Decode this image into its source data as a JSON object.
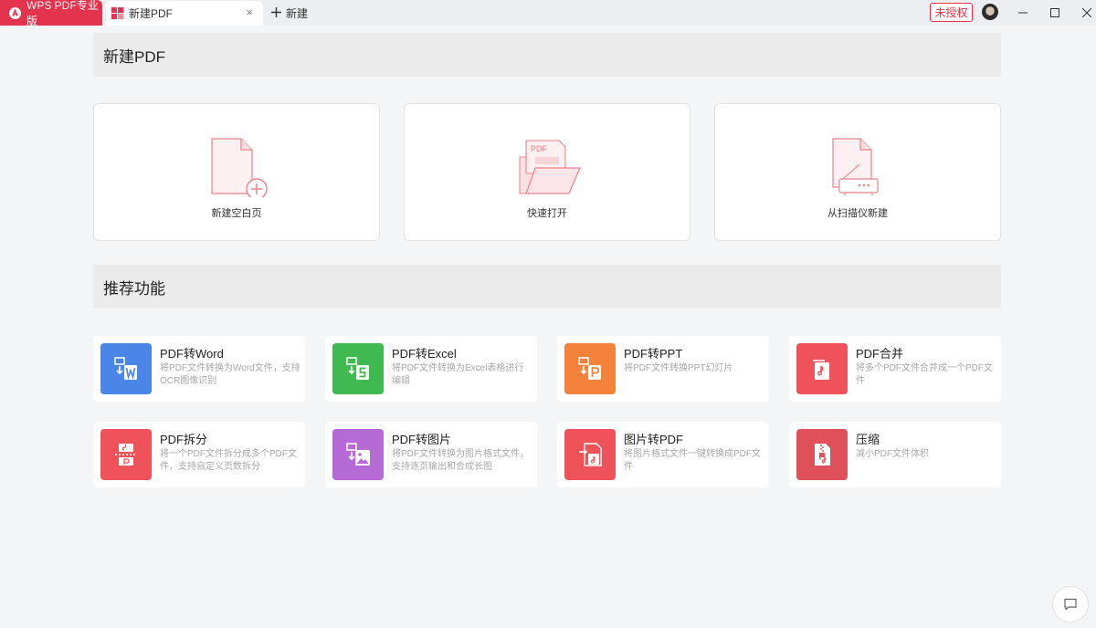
{
  "titlebar": {
    "app_name": "WPS PDF专业版",
    "doc_tab": "新建PDF",
    "close_glyph": "×",
    "new_tab_label": "新建",
    "unauthorized_label": "未授权"
  },
  "section_new": {
    "title": "新建PDF",
    "cards": [
      {
        "label": "新建空白页",
        "icon": "blank-page-plus-icon"
      },
      {
        "label": "快速打开",
        "icon": "open-folder-icon",
        "icon_text": "PDF"
      },
      {
        "label": "从扫描仪新建",
        "icon": "scanner-icon"
      }
    ]
  },
  "section_features": {
    "title": "推荐功能",
    "items": [
      {
        "title": "PDF转Word",
        "desc": "将PDF文件转换为Word文件，支持OCR图像识别",
        "color": "#4a86e8",
        "icon": "pdf-to-word-icon"
      },
      {
        "title": "PDF转Excel",
        "desc": "将PDF文件转换为Excel表格进行编辑",
        "color": "#3fb950",
        "icon": "pdf-to-excel-icon"
      },
      {
        "title": "PDF转PPT",
        "desc": "将PDF文件转换PPT幻灯片",
        "color": "#f5823a",
        "icon": "pdf-to-ppt-icon"
      },
      {
        "title": "PDF合并",
        "desc": "将多个PDF文件合并成一个PDF文件",
        "color": "#f0525a",
        "icon": "pdf-merge-icon"
      },
      {
        "title": "PDF拆分",
        "desc": "将一个PDF文件拆分成多个PDF文件，支持自定义页数拆分",
        "color": "#f0525a",
        "icon": "pdf-split-icon"
      },
      {
        "title": "PDF转图片",
        "desc": "将PDF文件转换为图片格式文件，支持逐页输出和合成长图",
        "color": "#b66ad6",
        "icon": "pdf-to-image-icon"
      },
      {
        "title": "图片转PDF",
        "desc": "将图片格式文件一键转换成PDF文件",
        "color": "#f0525a",
        "icon": "image-to-pdf-icon"
      },
      {
        "title": "压缩",
        "desc": "减小PDF文件体积",
        "color": "#e0505a",
        "icon": "compress-icon"
      }
    ]
  }
}
